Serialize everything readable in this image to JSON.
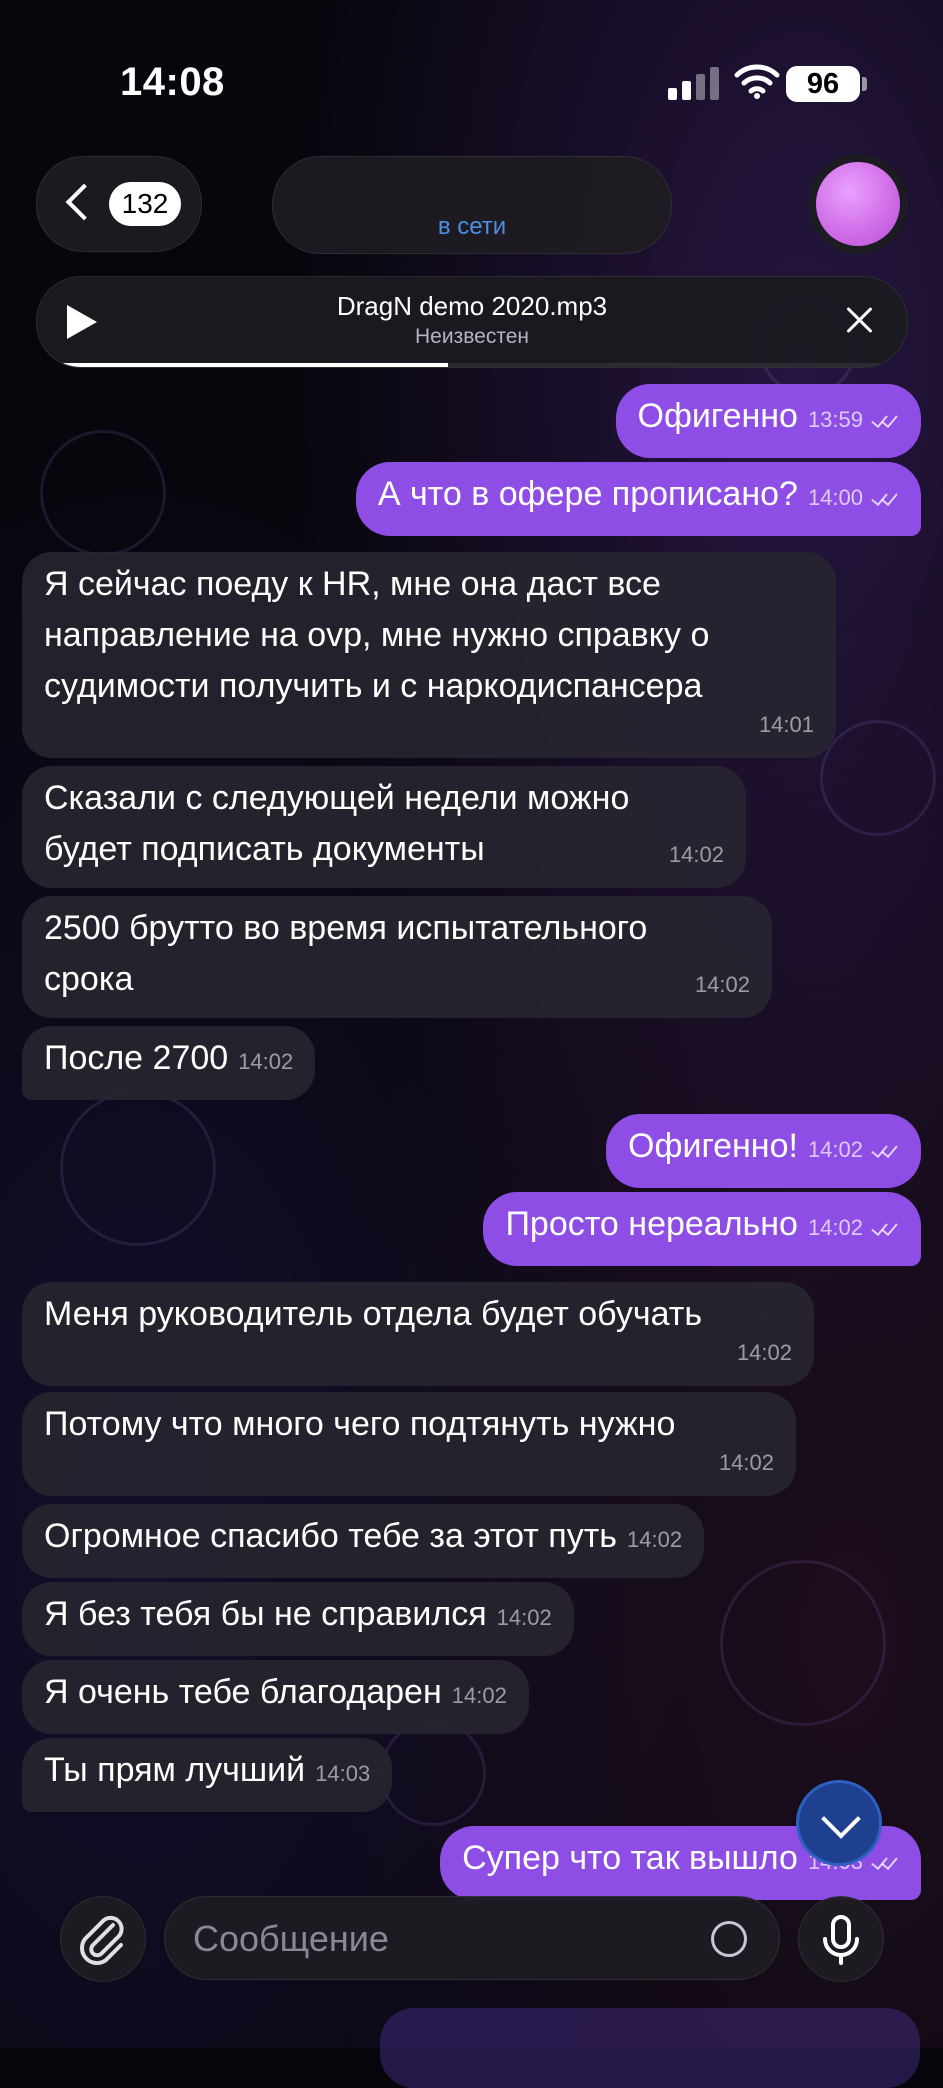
{
  "status_bar": {
    "time": "14:08",
    "battery": "96"
  },
  "header": {
    "back_count": "132",
    "status": "в сети"
  },
  "player": {
    "title": "DragN demo 2020.mp3",
    "artist": "Неизвестен",
    "progress": 0.47
  },
  "messages": [
    {
      "text": "Офигенно",
      "time": "13:59"
    },
    {
      "text": "А что в офере прописано?",
      "time": "14:00"
    },
    {
      "text": "Я сейчас поеду к HR, мне она даст все\nнаправление на ovp, мне нужно справку о\nсудимости получить и с наркодиспансера",
      "time": "14:01"
    },
    {
      "text": "Сказали с следующей недели можно\nбудет подписать документы",
      "time": "14:02"
    },
    {
      "text": "2500 брутто во время испытательного\nсрока",
      "time": "14:02"
    },
    {
      "text": "После 2700",
      "time": "14:02"
    },
    {
      "text": "Офигенно!",
      "time": "14:02"
    },
    {
      "text": "Просто нереально",
      "time": "14:02"
    },
    {
      "text": "Меня руководитель отдела будет обучать",
      "time": "14:02"
    },
    {
      "text": "Потому что много чего подтянуть нужно",
      "time": "14:02"
    },
    {
      "text": "Огромное спасибо тебе за этот путь",
      "time": "14:02"
    },
    {
      "text": "Я без тебя бы не справился",
      "time": "14:02"
    },
    {
      "text": "Я очень тебе благодарен",
      "time": "14:02"
    },
    {
      "text": "Ты прям лучший",
      "time": "14:03"
    },
    {
      "text": "Супер что так вышло",
      "time": "14:03"
    }
  ],
  "composer": {
    "placeholder": "Сообщение"
  },
  "colors": {
    "outgoing": "#8e4ee6",
    "incoming": "#28253a",
    "accent_blue": "#4d8fe0",
    "avatar": "#d56ef0"
  }
}
